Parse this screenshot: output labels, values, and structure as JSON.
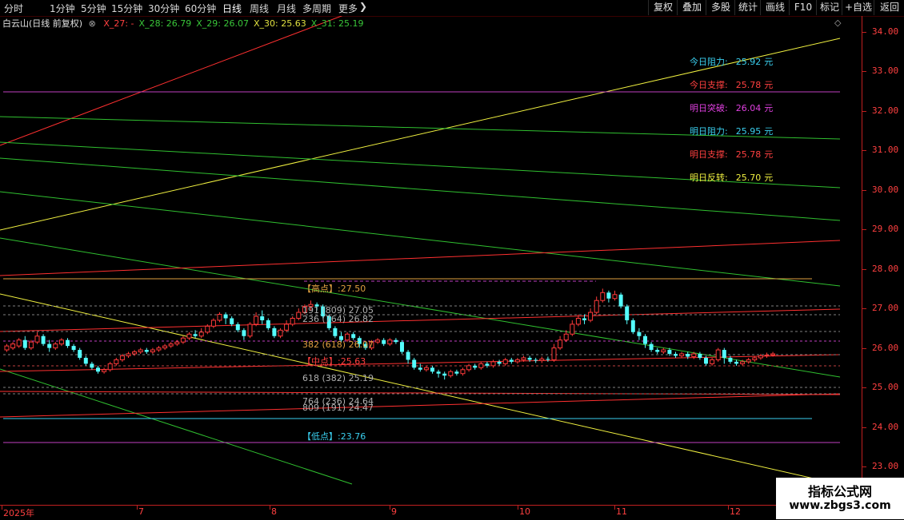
{
  "toolbar": {
    "periods": [
      "分时",
      "1分钟",
      "5分钟",
      "15分钟",
      "30分钟",
      "60分钟",
      "日线",
      "周线",
      "月线",
      "多周期",
      "更多"
    ],
    "active_period": "日线",
    "right_buttons": [
      "复权",
      "叠加",
      "多股",
      "统计",
      "画线",
      "F10",
      "+自选",
      "返回"
    ]
  },
  "header": {
    "title": "白云山(日线 前复权)",
    "indicators": [
      {
        "text": "X_27: -",
        "color": "#ff4040"
      },
      {
        "text": "X_28: 26.79",
        "color": "#39c639"
      },
      {
        "text": "X_29: 26.07",
        "color": "#39c639"
      },
      {
        "text": "X_30: 25.63",
        "color": "#e0e040"
      },
      {
        "text": "X_31: 25.19",
        "color": "#39c639"
      }
    ]
  },
  "info_panel": [
    {
      "label": "今日阻力:",
      "value": "25.92",
      "unit": "元",
      "color": "#3ad0f0"
    },
    {
      "label": "今日支撑:",
      "value": "25.78",
      "unit": "元",
      "color": "#ff4040"
    },
    {
      "label": "明日突破:",
      "value": "26.04",
      "unit": "元",
      "color": "#e040e0"
    },
    {
      "label": "明日阻力:",
      "value": "25.95",
      "unit": "元",
      "color": "#3ad0f0"
    },
    {
      "label": "明日支撑:",
      "value": "25.78",
      "unit": "元",
      "color": "#ff4040"
    },
    {
      "label": "明日反转:",
      "value": "25.70",
      "unit": "元",
      "color": "#f0f040"
    }
  ],
  "annotations": [
    {
      "text": "【高点】:27.50",
      "color": "#e0a040",
      "price": 27.5
    },
    {
      "text": "191 (809) 27.05",
      "color": "#b0b0b0",
      "price": 26.92
    },
    {
      "text": "236 (764) 26.82",
      "color": "#b0b0b0",
      "price": 26.69
    },
    {
      "text": "382 (618) 26.07",
      "color": "#e0a040",
      "price": 26.05
    },
    {
      "text": "【中点】:25.63",
      "color": "#ff4040",
      "price": 25.66
    },
    {
      "text": "618 (382) 25.19",
      "color": "#b0b0b0",
      "price": 25.21
    },
    {
      "text": "764 (236) 24.64",
      "color": "#b0b0b0",
      "price": 24.62
    },
    {
      "text": "809 (191) 24.47",
      "color": "#b0b0b0",
      "price": 24.45
    },
    {
      "text": "【低点】:23.76",
      "color": "#3ad0f0",
      "price": 23.76
    }
  ],
  "chart_data": {
    "type": "candlestick",
    "y_ticks": [
      "34.00",
      "33.00",
      "32.00",
      "31.00",
      "30.00",
      "29.00",
      "28.00",
      "27.00",
      "26.00",
      "25.00",
      "24.00",
      "23.00"
    ],
    "y_tick_values": [
      34,
      33,
      32,
      31,
      30,
      29,
      28,
      27,
      26,
      25,
      24,
      23
    ],
    "ylim": [
      22.03,
      34.4
    ],
    "x_labels": [
      "2025年",
      "7",
      "8",
      "9",
      "10",
      "11",
      "12"
    ],
    "candles": [
      [
        25.95,
        26.05,
        25.9,
        26.1
      ],
      [
        26.0,
        26.1,
        25.95,
        26.15
      ],
      [
        26.05,
        26.2,
        26.0,
        26.25
      ],
      [
        26.2,
        26.0,
        25.95,
        26.3
      ],
      [
        26.0,
        26.15,
        25.95,
        26.2
      ],
      [
        26.15,
        26.3,
        26.1,
        26.4
      ],
      [
        26.3,
        26.1,
        26.05,
        26.35
      ],
      [
        26.1,
        26.0,
        25.9,
        26.2
      ],
      [
        26.0,
        26.1,
        25.95,
        26.15
      ],
      [
        26.1,
        26.2,
        26.05,
        26.25
      ],
      [
        26.2,
        26.05,
        26.0,
        26.25
      ],
      [
        26.05,
        25.95,
        25.9,
        26.1
      ],
      [
        25.95,
        25.75,
        25.7,
        26.0
      ],
      [
        25.75,
        25.6,
        25.55,
        25.8
      ],
      [
        25.6,
        25.5,
        25.45,
        25.65
      ],
      [
        25.5,
        25.4,
        25.35,
        25.55
      ],
      [
        25.4,
        25.45,
        25.35,
        25.5
      ],
      [
        25.45,
        25.6,
        25.4,
        25.65
      ],
      [
        25.6,
        25.7,
        25.55,
        25.75
      ],
      [
        25.7,
        25.8,
        25.65,
        25.85
      ],
      [
        25.8,
        25.85,
        25.75,
        25.9
      ],
      [
        25.85,
        25.9,
        25.8,
        25.95
      ],
      [
        25.9,
        25.95,
        25.85,
        26.0
      ],
      [
        25.95,
        25.9,
        25.85,
        26.0
      ],
      [
        25.9,
        25.95,
        25.85,
        26.0
      ],
      [
        25.95,
        26.0,
        25.9,
        26.05
      ],
      [
        26.0,
        26.05,
        25.95,
        26.1
      ],
      [
        26.05,
        26.1,
        26.0,
        26.15
      ],
      [
        26.1,
        26.15,
        26.05,
        26.2
      ],
      [
        26.15,
        26.25,
        26.1,
        26.3
      ],
      [
        26.25,
        26.35,
        26.2,
        26.4
      ],
      [
        26.35,
        26.3,
        26.25,
        26.45
      ],
      [
        26.3,
        26.4,
        26.25,
        26.5
      ],
      [
        26.4,
        26.55,
        26.35,
        26.6
      ],
      [
        26.55,
        26.7,
        26.5,
        26.75
      ],
      [
        26.7,
        26.85,
        26.65,
        26.9
      ],
      [
        26.85,
        26.75,
        26.6,
        26.9
      ],
      [
        26.75,
        26.6,
        26.55,
        26.8
      ],
      [
        26.6,
        26.45,
        26.4,
        26.65
      ],
      [
        26.45,
        26.3,
        26.2,
        26.5
      ],
      [
        26.3,
        26.6,
        26.25,
        26.65
      ],
      [
        26.6,
        26.8,
        26.55,
        26.9
      ],
      [
        26.8,
        26.7,
        26.6,
        26.95
      ],
      [
        26.7,
        26.5,
        26.45,
        26.75
      ],
      [
        26.5,
        26.3,
        26.25,
        26.55
      ],
      [
        26.3,
        26.45,
        26.25,
        26.5
      ],
      [
        26.45,
        26.6,
        26.4,
        26.7
      ],
      [
        26.6,
        26.75,
        26.55,
        26.8
      ],
      [
        26.75,
        26.9,
        26.7,
        27.0
      ],
      [
        26.9,
        27.05,
        26.85,
        27.1
      ],
      [
        27.05,
        27.1,
        26.95,
        27.2
      ],
      [
        27.1,
        27.05,
        26.95,
        27.15
      ],
      [
        27.05,
        26.8,
        26.75,
        27.1
      ],
      [
        26.8,
        26.5,
        26.45,
        26.85
      ],
      [
        26.5,
        26.3,
        26.25,
        26.55
      ],
      [
        26.3,
        26.2,
        26.15,
        26.4
      ],
      [
        26.2,
        26.35,
        26.15,
        26.4
      ],
      [
        26.35,
        26.25,
        26.2,
        26.4
      ],
      [
        26.25,
        26.1,
        26.0,
        26.3
      ],
      [
        26.1,
        26.0,
        25.95,
        26.15
      ],
      [
        26.0,
        26.15,
        25.95,
        26.2
      ],
      [
        26.15,
        26.2,
        26.1,
        26.25
      ],
      [
        26.2,
        26.1,
        26.05,
        26.25
      ],
      [
        26.1,
        26.2,
        26.05,
        26.25
      ],
      [
        26.2,
        26.15,
        26.1,
        26.25
      ],
      [
        26.15,
        25.9,
        25.85,
        26.2
      ],
      [
        25.9,
        25.7,
        25.6,
        25.95
      ],
      [
        25.7,
        25.5,
        25.45,
        25.75
      ],
      [
        25.5,
        25.45,
        25.4,
        25.6
      ],
      [
        25.45,
        25.5,
        25.4,
        25.55
      ],
      [
        25.5,
        25.4,
        25.35,
        25.55
      ],
      [
        25.4,
        25.35,
        25.25,
        25.45
      ],
      [
        25.35,
        25.3,
        25.2,
        25.4
      ],
      [
        25.3,
        25.4,
        25.25,
        25.45
      ],
      [
        25.4,
        25.35,
        25.3,
        25.45
      ],
      [
        25.35,
        25.45,
        25.3,
        25.5
      ],
      [
        25.45,
        25.55,
        25.4,
        25.6
      ],
      [
        25.55,
        25.5,
        25.45,
        25.6
      ],
      [
        25.5,
        25.6,
        25.45,
        25.65
      ],
      [
        25.6,
        25.55,
        25.5,
        25.65
      ],
      [
        25.55,
        25.65,
        25.5,
        25.7
      ],
      [
        25.65,
        25.6,
        25.55,
        25.7
      ],
      [
        25.6,
        25.7,
        25.55,
        25.75
      ],
      [
        25.7,
        25.65,
        25.6,
        25.75
      ],
      [
        25.65,
        25.7,
        25.6,
        25.75
      ],
      [
        25.7,
        25.75,
        25.65,
        25.8
      ],
      [
        25.75,
        25.7,
        25.65,
        25.8
      ],
      [
        25.7,
        25.68,
        25.62,
        25.75
      ],
      [
        25.68,
        25.72,
        25.62,
        25.78
      ],
      [
        25.72,
        25.7,
        25.65,
        25.78
      ],
      [
        25.7,
        26.0,
        25.65,
        26.1
      ],
      [
        26.0,
        26.2,
        25.95,
        26.3
      ],
      [
        26.2,
        26.35,
        26.15,
        26.45
      ],
      [
        26.35,
        26.6,
        26.3,
        26.7
      ],
      [
        26.6,
        26.75,
        26.55,
        26.85
      ],
      [
        26.75,
        26.7,
        26.6,
        26.85
      ],
      [
        26.7,
        26.9,
        26.65,
        27.0
      ],
      [
        26.9,
        27.2,
        26.85,
        27.3
      ],
      [
        27.2,
        27.4,
        27.15,
        27.5
      ],
      [
        27.4,
        27.25,
        27.15,
        27.45
      ],
      [
        27.25,
        27.35,
        27.2,
        27.45
      ],
      [
        27.35,
        27.05,
        27.0,
        27.4
      ],
      [
        27.05,
        26.7,
        26.6,
        27.1
      ],
      [
        26.7,
        26.4,
        26.35,
        26.75
      ],
      [
        26.4,
        26.3,
        26.2,
        26.5
      ],
      [
        26.3,
        26.1,
        26.0,
        26.35
      ],
      [
        26.1,
        25.95,
        25.9,
        26.15
      ],
      [
        25.95,
        25.9,
        25.85,
        26.0
      ],
      [
        25.9,
        25.95,
        25.85,
        26.0
      ],
      [
        25.95,
        25.85,
        25.8,
        26.0
      ],
      [
        25.85,
        25.8,
        25.75,
        25.9
      ],
      [
        25.8,
        25.85,
        25.75,
        25.9
      ],
      [
        25.85,
        25.78,
        25.72,
        25.9
      ],
      [
        25.78,
        25.85,
        25.72,
        25.9
      ],
      [
        25.85,
        25.75,
        25.7,
        25.9
      ],
      [
        25.75,
        25.6,
        25.55,
        25.8
      ],
      [
        25.6,
        25.7,
        25.55,
        25.75
      ],
      [
        25.7,
        25.95,
        25.65,
        26.0
      ],
      [
        25.95,
        25.75,
        25.6,
        26.0
      ],
      [
        25.75,
        25.65,
        25.6,
        25.8
      ],
      [
        25.65,
        25.6,
        25.55,
        25.7
      ],
      [
        25.6,
        25.65,
        25.55,
        25.7
      ],
      [
        25.65,
        25.7,
        25.6,
        25.75
      ],
      [
        25.7,
        25.75,
        25.65,
        25.8
      ],
      [
        25.75,
        25.8,
        25.7,
        25.85
      ],
      [
        25.8,
        25.82,
        25.75,
        25.88
      ],
      [
        25.82,
        25.85,
        25.78,
        25.9
      ]
    ]
  },
  "watermark": {
    "line1": "指标公式网",
    "line2": "www.zbgs3.com"
  }
}
